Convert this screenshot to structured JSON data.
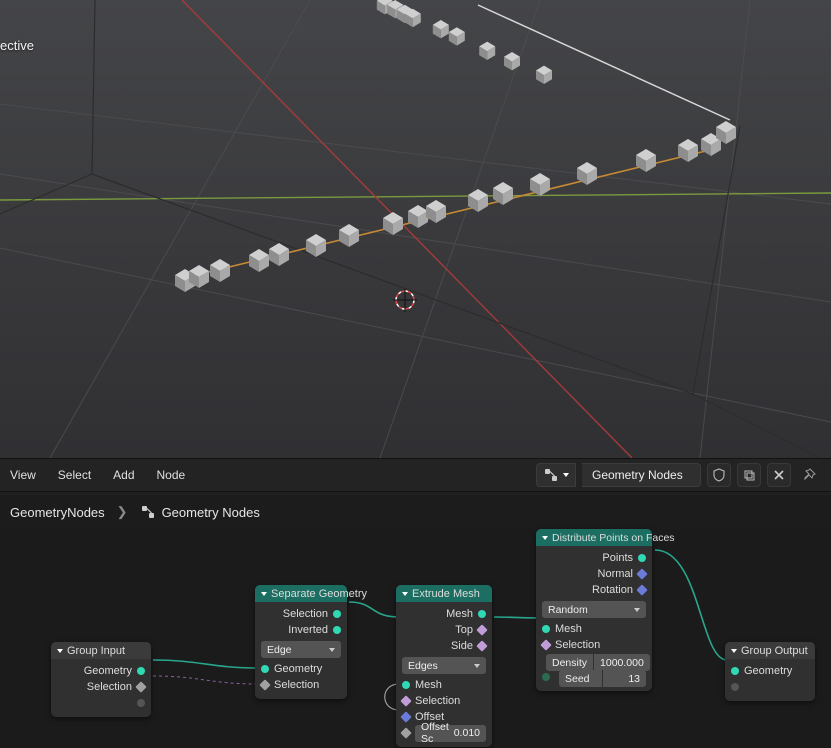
{
  "viewport": {
    "overlay_text": "ective"
  },
  "menu": {
    "items": [
      "View",
      "Select",
      "Add",
      "Node"
    ],
    "workspace_name": "Geometry Nodes"
  },
  "breadcrumb": {
    "root": "GeometryNodes",
    "current": "Geometry Nodes"
  },
  "nodes": {
    "group_input": {
      "title": "Group Input",
      "outputs": [
        "Geometry",
        "Selection"
      ]
    },
    "separate_geometry": {
      "title": "Separate Geometry",
      "outputs": [
        "Selection",
        "Inverted"
      ],
      "mode_label": "Edge",
      "inputs": [
        "Geometry",
        "Selection"
      ]
    },
    "extrude_mesh": {
      "title": "Extrude Mesh",
      "outputs": [
        "Mesh",
        "Top",
        "Side"
      ],
      "mode_label": "Edges",
      "inputs": [
        "Mesh",
        "Selection",
        "Offset"
      ],
      "offset_scale_label": "Offset Sc",
      "offset_scale_value": "0.010"
    },
    "distribute_points": {
      "title": "Distribute Points on Faces",
      "outputs": [
        "Points",
        "Normal",
        "Rotation"
      ],
      "mode_label": "Random",
      "inputs": [
        "Mesh",
        "Selection"
      ],
      "density_label": "Density",
      "density_value": "1000.000",
      "seed_label": "Seed",
      "seed_value": "13"
    },
    "group_output": {
      "title": "Group Output",
      "inputs": [
        "Geometry"
      ]
    }
  }
}
